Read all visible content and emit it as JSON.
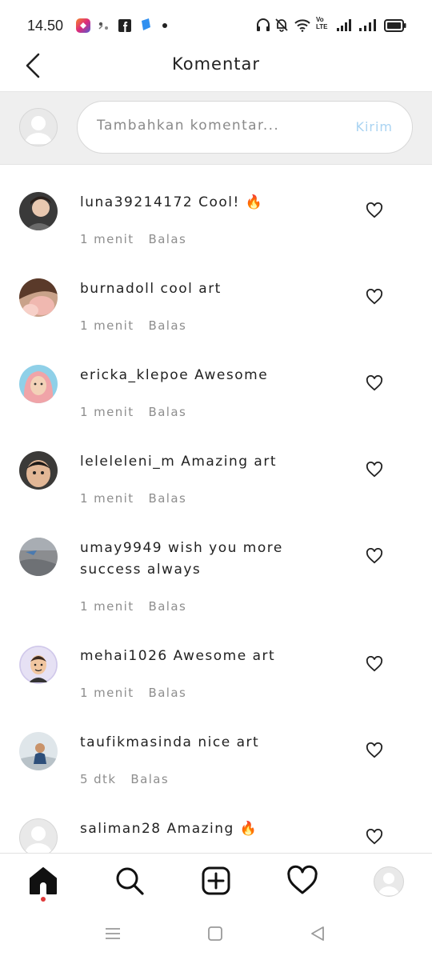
{
  "status_bar": {
    "time": "14.50",
    "volte": "Vo\nLTE"
  },
  "header": {
    "title": "Komentar"
  },
  "composer": {
    "placeholder": "Tambahkan komentar...",
    "send_label": "Kirim"
  },
  "comments": [
    {
      "username": "luna39214172",
      "text": "Cool! 🔥",
      "time": "1 menit",
      "reply": "Balas"
    },
    {
      "username": "burnadoll",
      "text": "cool art",
      "time": "1 menit",
      "reply": "Balas"
    },
    {
      "username": "ericka_klepoe",
      "text": "Awesome",
      "time": "1 menit",
      "reply": "Balas"
    },
    {
      "username": "leleleleni_m",
      "text": "Amazing art",
      "time": "1 menit",
      "reply": "Balas"
    },
    {
      "username": "umay9949",
      "text": "wish you more success always",
      "time": "1 menit",
      "reply": "Balas"
    },
    {
      "username": "mehai1026",
      "text": "Awesome art",
      "time": "1 menit",
      "reply": "Balas"
    },
    {
      "username": "taufikmasinda",
      "text": "nice art",
      "time": "5 dtk",
      "reply": "Balas"
    },
    {
      "username": "saliman28",
      "text": "Amazing 🔥",
      "time": "",
      "reply": ""
    }
  ],
  "icons": {
    "back": "arrow-left-icon",
    "heart": "heart-outline-icon",
    "home": "home-icon",
    "search": "search-icon",
    "add": "add-post-icon",
    "activity": "heart-icon",
    "profile": "profile-avatar"
  },
  "colors": {
    "send": "#a9d3f2",
    "notification_dot": "#e03a3a",
    "composer_bg": "#efefef"
  }
}
